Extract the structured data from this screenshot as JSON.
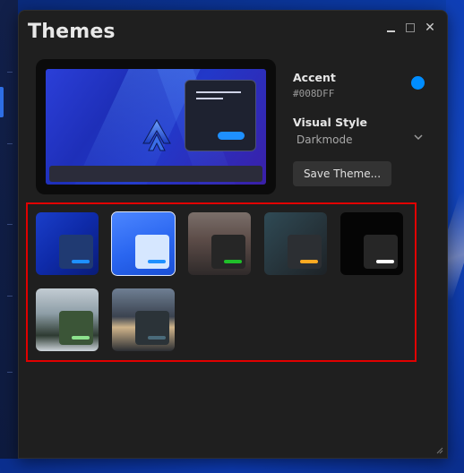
{
  "window": {
    "title": "Themes",
    "controls": {
      "minimize": "minimize",
      "maximize": "maximize",
      "close": "✕"
    }
  },
  "accent": {
    "label": "Accent",
    "value": "#008DFF",
    "color": "#008DFF"
  },
  "visual_style": {
    "label": "Visual Style",
    "selected": "Darkmode"
  },
  "save_button": {
    "label": "Save Theme..."
  },
  "themes": [
    {
      "name": "theme-blue-waves",
      "bg": "linear-gradient(135deg,#1a3ec9 0%,#0e2aa8 50%,#0a1c77 100%)",
      "card": "#203a72",
      "accent": "#1e90ff",
      "selected": false
    },
    {
      "name": "theme-light-blue",
      "bg": "linear-gradient(160deg,#4c86ff 0%,#2a66f0 55%,#1a4fd6 100%)",
      "card": "#d6e7ff",
      "accent": "#1e90ff",
      "selected": true
    },
    {
      "name": "theme-city-canal",
      "bg": "linear-gradient(180deg,#7b6f6a 0%,#5b4b47 45%,#2f2a2a 100%)",
      "card": "#262626",
      "accent": "#1fbf2a",
      "selected": false
    },
    {
      "name": "theme-dark-teal",
      "bg": "linear-gradient(135deg,#2f4a55 0%,#26343b 55%,#1d2226 100%)",
      "card": "#2c2f33",
      "accent": "#ffaa22",
      "selected": false
    },
    {
      "name": "theme-black",
      "bg": "#050505",
      "card": "#262626",
      "accent": "#ffffff",
      "selected": false
    },
    {
      "name": "theme-snowy-forest",
      "bg": "linear-gradient(180deg,#c3ccd3 0%,#8e9ea7 40%,#2e3b32 75%,#cfd6dc 100%)",
      "card": "#3b5537",
      "accent": "#8de28d",
      "selected": false
    },
    {
      "name": "theme-sunset-water",
      "bg": "linear-gradient(180deg,#6f7f93 0%,#3b4350 45%,#cfb48a 62%,#2b2e33 100%)",
      "card": "#2b3338",
      "accent": "#4a6b7a",
      "selected": false
    }
  ]
}
